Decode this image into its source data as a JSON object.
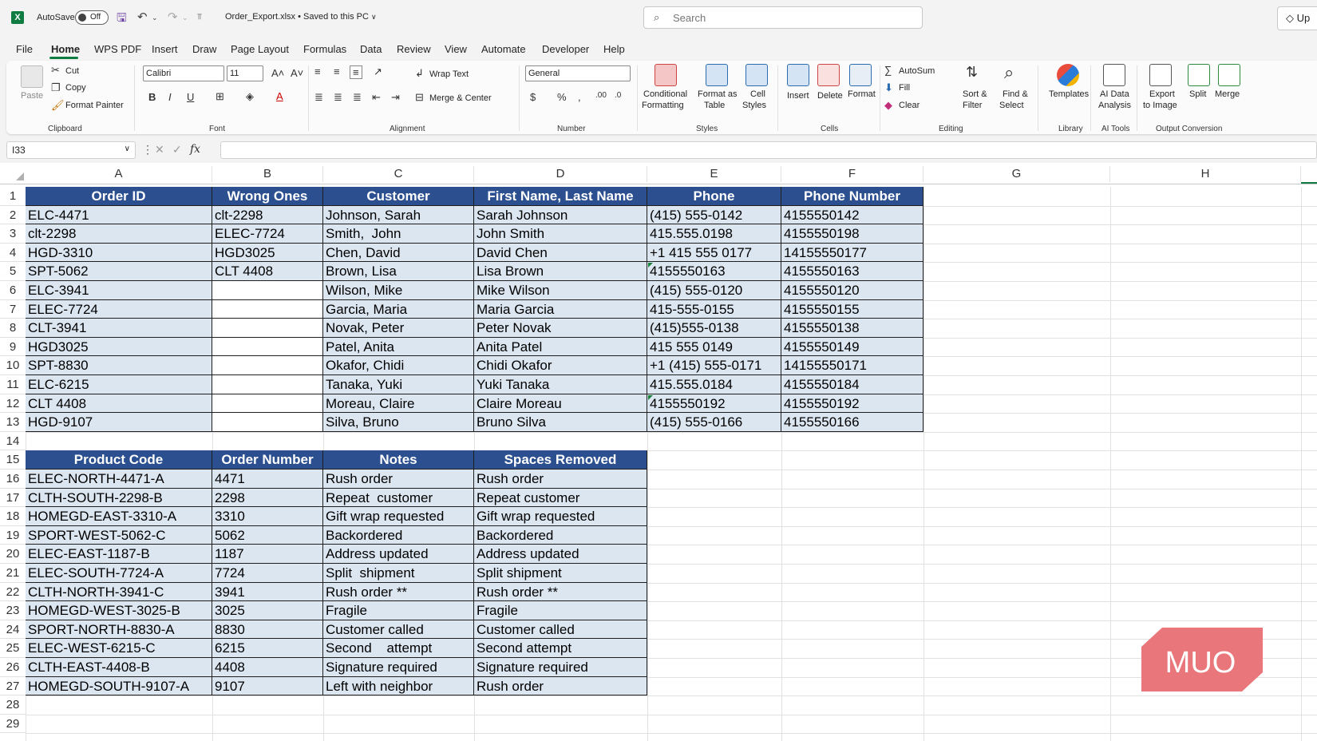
{
  "titlebar": {
    "autosave_label": "AutoSave",
    "autosave_state": "Off",
    "doc_title": "Order_Export.xlsx • Saved to this PC",
    "search_placeholder": "Search",
    "upgrade_label": "Up"
  },
  "menu": [
    "File",
    "Home",
    "WPS PDF",
    "Insert",
    "Draw",
    "Page Layout",
    "Formulas",
    "Data",
    "Review",
    "View",
    "Automate",
    "Developer",
    "Help"
  ],
  "ribbon": {
    "clipboard": {
      "paste": "Paste",
      "cut": "Cut",
      "copy": "Copy",
      "format_painter": "Format Painter",
      "group": "Clipboard"
    },
    "font": {
      "name": "Calibri",
      "size": "11",
      "group": "Font"
    },
    "alignment": {
      "wrap": "Wrap Text",
      "merge": "Merge & Center",
      "group": "Alignment"
    },
    "number": {
      "format": "General",
      "group": "Number"
    },
    "styles": {
      "conditional": "Conditional",
      "conditional2": "Formatting",
      "format_as": "Format as",
      "format_as2": "Table",
      "cell": "Cell",
      "cell2": "Styles",
      "group": "Styles"
    },
    "cells": {
      "insert": "Insert",
      "delete": "Delete",
      "format": "Format",
      "group": "Cells"
    },
    "editing": {
      "autosum": "AutoSum",
      "fill": "Fill",
      "clear": "Clear",
      "sort": "Sort &",
      "sort2": "Filter",
      "find": "Find &",
      "find2": "Select",
      "group": "Editing"
    },
    "library": {
      "templates": "Templates",
      "group": "Library"
    },
    "ai": {
      "label": "AI Data",
      "label2": "Analysis",
      "group": "AI Tools"
    },
    "output": {
      "export": "Export",
      "export2": "to Image",
      "split": "Split",
      "merge": "Merge",
      "group": "Output Conversion"
    }
  },
  "formula_bar": {
    "name_box": "I33",
    "fx": "fx"
  },
  "columns": [
    "A",
    "B",
    "C",
    "D",
    "E",
    "F",
    "G",
    "H"
  ],
  "rows": [
    "1",
    "2",
    "3",
    "4",
    "5",
    "6",
    "7",
    "8",
    "9",
    "10",
    "11",
    "12",
    "13",
    "14",
    "15",
    "16",
    "17",
    "18",
    "19",
    "20",
    "21",
    "22",
    "23",
    "24",
    "25",
    "26",
    "27",
    "28",
    "29"
  ],
  "table1": {
    "headers": [
      "Order ID",
      "Wrong Ones",
      "Customer",
      "First Name, Last Name",
      "Phone",
      "Phone Number"
    ],
    "rows": [
      [
        "ELC-4471",
        "clt-2298",
        "Johnson, Sarah",
        "Sarah Johnson",
        "(415) 555-0142",
        "4155550142"
      ],
      [
        "clt-2298",
        "ELEC-7724",
        "Smith,  John",
        "John Smith",
        "415.555.0198",
        "4155550198"
      ],
      [
        "HGD-3310",
        "HGD3025",
        "Chen, David",
        "David Chen",
        "+1 415 555 0177",
        "14155550177"
      ],
      [
        "SPT-5062",
        "CLT 4408",
        "Brown, Lisa",
        "Lisa Brown",
        "4155550163",
        "4155550163"
      ],
      [
        "ELC-3941",
        "",
        "Wilson, Mike",
        "Mike Wilson",
        "(415) 555-0120",
        "4155550120"
      ],
      [
        "ELEC-7724",
        "",
        "Garcia, Maria",
        "Maria Garcia",
        "415-555-0155",
        "4155550155"
      ],
      [
        "CLT-3941",
        "",
        "Novak, Peter",
        "Peter Novak",
        "(415)555-0138",
        "4155550138"
      ],
      [
        "HGD3025",
        "",
        "Patel, Anita",
        "Anita Patel",
        "415 555 0149",
        "4155550149"
      ],
      [
        "SPT-8830",
        "",
        "Okafor, Chidi",
        "Chidi Okafor",
        "+1 (415) 555-0171",
        "14155550171"
      ],
      [
        "ELC-6215",
        "",
        "Tanaka, Yuki",
        "Yuki Tanaka",
        "415.555.0184",
        "4155550184"
      ],
      [
        "CLT 4408",
        "",
        "Moreau, Claire",
        "Claire Moreau",
        "4155550192",
        "4155550192"
      ],
      [
        "HGD-9107",
        "",
        "Silva, Bruno",
        "Bruno Silva",
        "(415) 555-0166",
        "4155550166"
      ]
    ]
  },
  "table2": {
    "headers": [
      "Product Code",
      "Order Number",
      "Notes",
      "Spaces Removed"
    ],
    "rows": [
      [
        "ELEC-NORTH-4471-A",
        "4471",
        "Rush order",
        "Rush order"
      ],
      [
        "CLTH-SOUTH-2298-B",
        "2298",
        "Repeat  customer",
        "Repeat customer"
      ],
      [
        "HOMEGD-EAST-3310-A",
        "3310",
        "Gift wrap requested",
        "Gift wrap requested"
      ],
      [
        "SPORT-WEST-5062-C",
        "5062",
        "Backordered",
        "Backordered"
      ],
      [
        "ELEC-EAST-1187-B",
        "1187",
        "Address updated",
        "Address updated"
      ],
      [
        "ELEC-SOUTH-7724-A",
        "7724",
        "Split  shipment",
        "Split shipment"
      ],
      [
        "CLTH-NORTH-3941-C",
        "3941",
        "Rush order **",
        "Rush order **"
      ],
      [
        "HOMEGD-WEST-3025-B",
        "3025",
        "Fragile",
        "Fragile"
      ],
      [
        "SPORT-NORTH-8830-A",
        "8830",
        "Customer called",
        "Customer called"
      ],
      [
        "ELEC-WEST-6215-C",
        "6215",
        "Second    attempt",
        "Second attempt"
      ],
      [
        "CLTH-EAST-4408-B",
        "4408",
        "Signature required",
        "Signature required"
      ],
      [
        "HOMEGD-SOUTH-9107-A",
        "9107",
        "Left with neighbor",
        "Rush order"
      ]
    ]
  },
  "watermark": "MUO",
  "colors": {
    "header_fill": "#2b4f8f",
    "data_fill": "#dce6f1",
    "accent": "#107c41",
    "watermark": "#e8767a"
  }
}
